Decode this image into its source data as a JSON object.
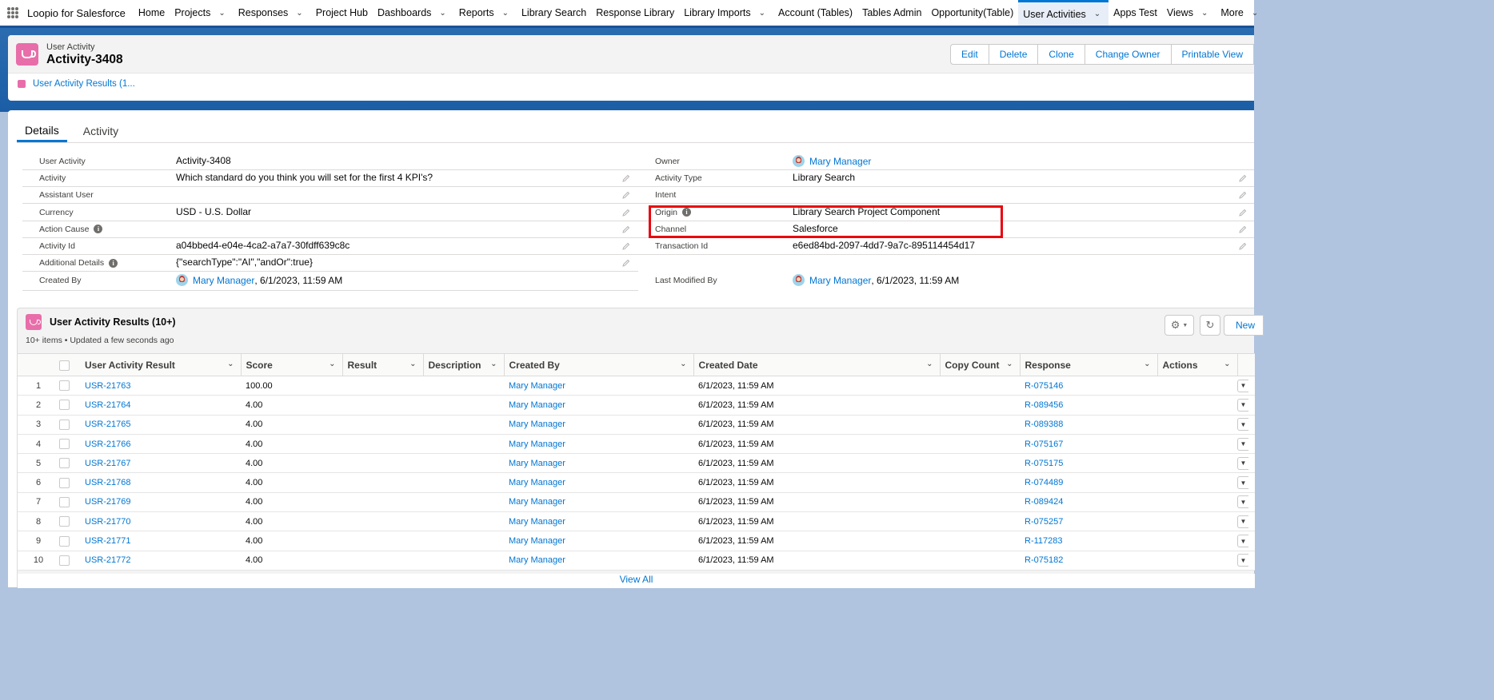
{
  "nav": {
    "app_name": "Loopio for Salesforce",
    "items": [
      {
        "label": "Home",
        "chevron": false
      },
      {
        "label": "Projects",
        "chevron": true
      },
      {
        "label": "Responses",
        "chevron": true
      },
      {
        "label": "Project Hub",
        "chevron": false
      },
      {
        "label": "Dashboards",
        "chevron": true
      },
      {
        "label": "Reports",
        "chevron": true
      },
      {
        "label": "Library Search",
        "chevron": false
      },
      {
        "label": "Response Library",
        "chevron": false
      },
      {
        "label": "Library Imports",
        "chevron": true
      },
      {
        "label": "Account (Tables)",
        "chevron": false
      },
      {
        "label": "Tables Admin",
        "chevron": false
      },
      {
        "label": "Opportunity(Table)",
        "chevron": false
      },
      {
        "label": "User Activities",
        "chevron": true,
        "active": true
      },
      {
        "label": "Apps Test",
        "chevron": false
      },
      {
        "label": "Views",
        "chevron": true
      },
      {
        "label": "More",
        "chevron": true
      }
    ]
  },
  "header": {
    "object_label": "User Activity",
    "record_title": "Activity-3408",
    "buttons": [
      "Edit",
      "Delete",
      "Clone",
      "Change Owner",
      "Printable View"
    ],
    "related_link": "User Activity Results (1..."
  },
  "tabs": [
    "Details",
    "Activity"
  ],
  "fields_left": [
    {
      "label": "User Activity",
      "value": "Activity-3408",
      "edit": false
    },
    {
      "label": "Activity",
      "value": "Which standard do you think you will set for the first 4 KPI's?",
      "edit": true
    },
    {
      "label": "Assistant User",
      "value": "",
      "edit": true
    },
    {
      "label": "Currency",
      "value": "USD - U.S. Dollar",
      "edit": true
    },
    {
      "label": "Action Cause",
      "value": "",
      "edit": true,
      "info": true
    },
    {
      "label": "Activity Id",
      "value": "a04bbed4-e04e-4ca2-a7a7-30fdff639c8c",
      "edit": true
    },
    {
      "label": "Additional Details",
      "value": "{\"searchType\":\"AI\",\"andOr\":true}",
      "edit": true,
      "info": true
    }
  ],
  "created_by": {
    "label": "Created By",
    "user": "Mary Manager",
    "date": ", 6/1/2023, 11:59 AM"
  },
  "fields_right": [
    {
      "label": "Owner",
      "value": "Mary Manager",
      "edit": false,
      "user": true
    },
    {
      "label": "Activity Type",
      "value": "Library Search",
      "edit": true
    },
    {
      "label": "Intent",
      "value": "",
      "edit": true
    },
    {
      "label": "Origin",
      "value": "Library Search Project Component",
      "edit": true,
      "info": true
    },
    {
      "label": "Channel",
      "value": "Salesforce",
      "edit": true
    },
    {
      "label": "Transaction Id",
      "value": "e6ed84bd-2097-4dd7-9a7c-895114454d17",
      "edit": true
    }
  ],
  "last_modified": {
    "label": "Last Modified By",
    "user": "Mary Manager",
    "date": ", 6/1/2023, 11:59 AM"
  },
  "related_list": {
    "title": "User Activity Results (10+)",
    "subtitle": "10+ items • Updated a few seconds ago",
    "new_label": "New",
    "columns": [
      "User Activity Result",
      "Score",
      "Result",
      "Description",
      "Created By",
      "Created Date",
      "Copy Count",
      "Response",
      "Actions"
    ],
    "rows": [
      {
        "n": "1",
        "id": "USR-21763",
        "score": "100.00",
        "created_by": "Mary Manager",
        "created_date": "6/1/2023, 11:59 AM",
        "response": "R-075146"
      },
      {
        "n": "2",
        "id": "USR-21764",
        "score": "4.00",
        "created_by": "Mary Manager",
        "created_date": "6/1/2023, 11:59 AM",
        "response": "R-089456"
      },
      {
        "n": "3",
        "id": "USR-21765",
        "score": "4.00",
        "created_by": "Mary Manager",
        "created_date": "6/1/2023, 11:59 AM",
        "response": "R-089388"
      },
      {
        "n": "4",
        "id": "USR-21766",
        "score": "4.00",
        "created_by": "Mary Manager",
        "created_date": "6/1/2023, 11:59 AM",
        "response": "R-075167"
      },
      {
        "n": "5",
        "id": "USR-21767",
        "score": "4.00",
        "created_by": "Mary Manager",
        "created_date": "6/1/2023, 11:59 AM",
        "response": "R-075175"
      },
      {
        "n": "6",
        "id": "USR-21768",
        "score": "4.00",
        "created_by": "Mary Manager",
        "created_date": "6/1/2023, 11:59 AM",
        "response": "R-074489"
      },
      {
        "n": "7",
        "id": "USR-21769",
        "score": "4.00",
        "created_by": "Mary Manager",
        "created_date": "6/1/2023, 11:59 AM",
        "response": "R-089424"
      },
      {
        "n": "8",
        "id": "USR-21770",
        "score": "4.00",
        "created_by": "Mary Manager",
        "created_date": "6/1/2023, 11:59 AM",
        "response": "R-075257"
      },
      {
        "n": "9",
        "id": "USR-21771",
        "score": "4.00",
        "created_by": "Mary Manager",
        "created_date": "6/1/2023, 11:59 AM",
        "response": "R-117283"
      },
      {
        "n": "10",
        "id": "USR-21772",
        "score": "4.00",
        "created_by": "Mary Manager",
        "created_date": "6/1/2023, 11:59 AM",
        "response": "R-075182"
      }
    ],
    "view_all": "View All"
  },
  "colors": {
    "brand": "#0176d3",
    "object_icon": "#e86eaa",
    "highlight": "#e8050f"
  }
}
